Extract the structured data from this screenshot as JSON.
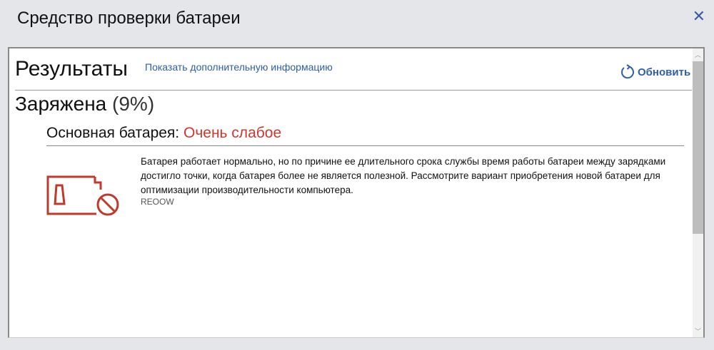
{
  "window": {
    "title": "Средство проверки батареи",
    "close_icon": "close-icon"
  },
  "results": {
    "heading": "Результаты",
    "more_info_link": "Показать дополнительную информацию",
    "refresh_label": "Обновить"
  },
  "status": {
    "label": "Заряжена",
    "percent": "(9%)"
  },
  "battery": {
    "name": "Основная батарея:",
    "condition": "Очень слабое",
    "description": "Батарея работает нормально, но по причине ее длительного срока службы время работы батареи между зарядками достигло точки, когда батарея более не является полезной. Рассмотрите вариант приобретения новой батареи для оптимизации производительности компьютера.",
    "code": "REOOW"
  },
  "colors": {
    "accent": "#2d5ea8",
    "warning": "#d0362c",
    "icon": "#c0392b"
  }
}
